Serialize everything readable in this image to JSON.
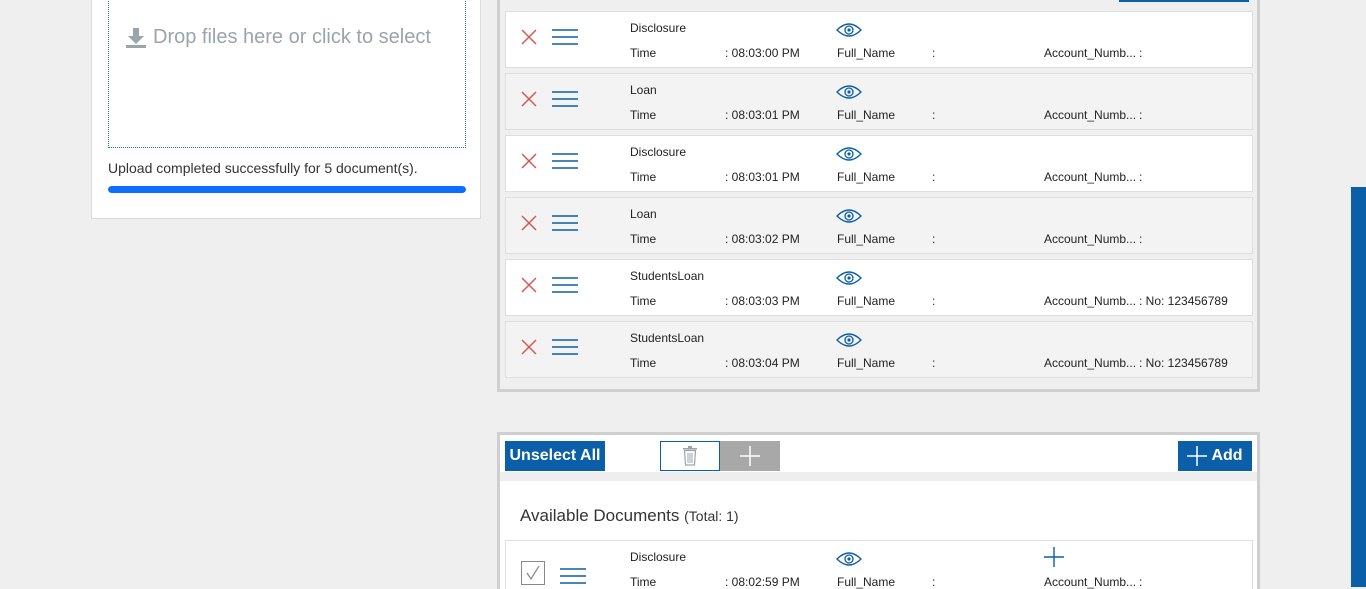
{
  "upload": {
    "drop_text": "Drop files here or click to select",
    "status": "Upload completed successfully for 5 document(s).",
    "progress": 1.0
  },
  "documents": [
    {
      "name": "Disclosure",
      "time_label": "Time",
      "time_value": ": 08:03:00 PM",
      "name_label": "Full_Name",
      "name_value": ":",
      "acct_label": "Account_Numb...",
      "acct_value": ":",
      "shade": "white"
    },
    {
      "name": "Loan",
      "time_label": "Time",
      "time_value": ": 08:03:01 PM",
      "name_label": "Full_Name",
      "name_value": ":",
      "acct_label": "Account_Numb...",
      "acct_value": ":",
      "shade": "grey"
    },
    {
      "name": "Disclosure",
      "time_label": "Time",
      "time_value": ": 08:03:01 PM",
      "name_label": "Full_Name",
      "name_value": ":",
      "acct_label": "Account_Numb...",
      "acct_value": ":",
      "shade": "white"
    },
    {
      "name": "Loan",
      "time_label": "Time",
      "time_value": ": 08:03:02 PM",
      "name_label": "Full_Name",
      "name_value": ":",
      "acct_label": "Account_Numb...",
      "acct_value": ":",
      "shade": "grey"
    },
    {
      "name": "StudentsLoan",
      "time_label": "Time",
      "time_value": ": 08:03:03 PM",
      "name_label": "Full_Name",
      "name_value": ":",
      "acct_label": "Account_Numb...",
      "acct_value": ": No: 123456789",
      "shade": "white"
    },
    {
      "name": "StudentsLoan",
      "time_label": "Time",
      "time_value": ": 08:03:04 PM",
      "name_label": "Full_Name",
      "name_value": ":",
      "acct_label": "Account_Numb...",
      "acct_value": ": No: 123456789",
      "shade": "grey"
    }
  ],
  "available": {
    "unselect_label": "Unselect All",
    "add_label": "Add",
    "title": "Available Documents",
    "count": "(Total: 1)",
    "items": [
      {
        "name": "Disclosure",
        "time_label": "Time",
        "time_value": ": 08:02:59 PM",
        "name_label": "Full_Name",
        "name_value": ":",
        "acct_label": "Account_Numb...",
        "acct_value": ":"
      }
    ]
  },
  "icons": {
    "remove": "x-icon",
    "drag": "menu-icon",
    "view": "eye-icon",
    "delete": "trash-icon",
    "add": "plus-icon",
    "upload": "download-icon",
    "select": "checkbox-icon"
  },
  "colors": {
    "accent": "#0b5ea8",
    "progress": "#0d6efd",
    "remove": "#d9534f"
  }
}
